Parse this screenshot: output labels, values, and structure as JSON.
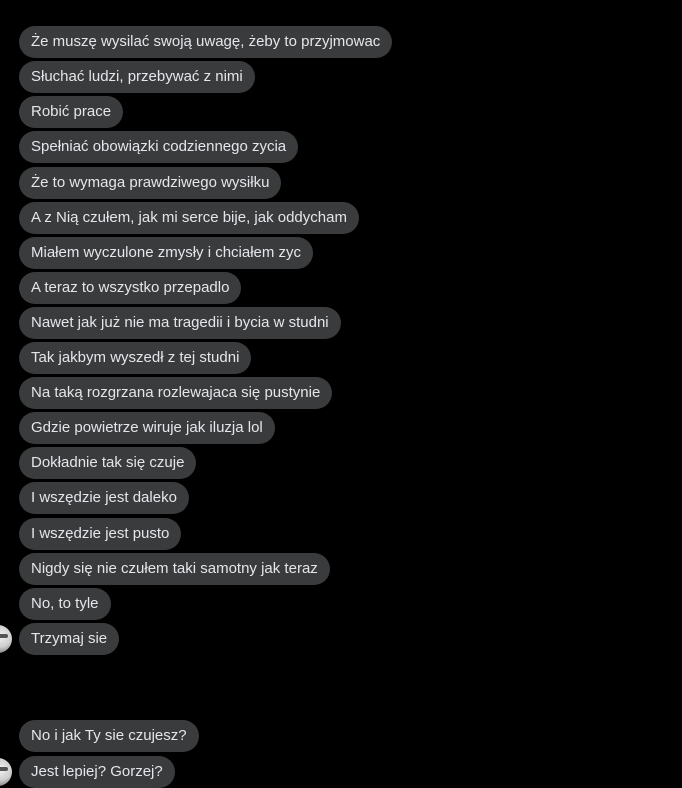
{
  "messages": [
    {
      "text": "Że muszę wysilać swoją uwagę, żeby to przyjmowac"
    },
    {
      "text": "Słuchać ludzi, przebywać z nimi"
    },
    {
      "text": "Robić prace"
    },
    {
      "text": "Spełniać obowiązki codziennego zycia"
    },
    {
      "text": "Że to wymaga prawdziwego wysiłku"
    },
    {
      "text": "A z Nią czułem, jak mi serce bije, jak oddycham"
    },
    {
      "text": "Miałem wyczulone zmysły i chciałem zyc"
    },
    {
      "text": "A teraz to wszystko przepadlo"
    },
    {
      "text": "Nawet jak już nie ma tragedii i bycia w studni"
    },
    {
      "text": "Tak jakbym wyszedł z tej studni"
    },
    {
      "text": "Na taką rozgrzana rozlewajaca się pustynie"
    },
    {
      "text": "Gdzie powietrze wiruje jak iluzja lol"
    },
    {
      "text": "Dokładnie tak się czuje"
    },
    {
      "text": "I wszędzie jest daleko"
    },
    {
      "text": "I wszędzie jest pusto"
    },
    {
      "text": "Nigdy się nie czułem taki samotny jak teraz"
    },
    {
      "text": "No, to tyle"
    },
    {
      "text": "Trzymaj sie"
    },
    {
      "text": "No i jak Ty sie czujesz?"
    },
    {
      "text": "Jest lepiej? Gorzej?"
    }
  ],
  "colors": {
    "background": "#000000",
    "bubble": "#3a3b3c",
    "text": "#e4e6eb"
  }
}
